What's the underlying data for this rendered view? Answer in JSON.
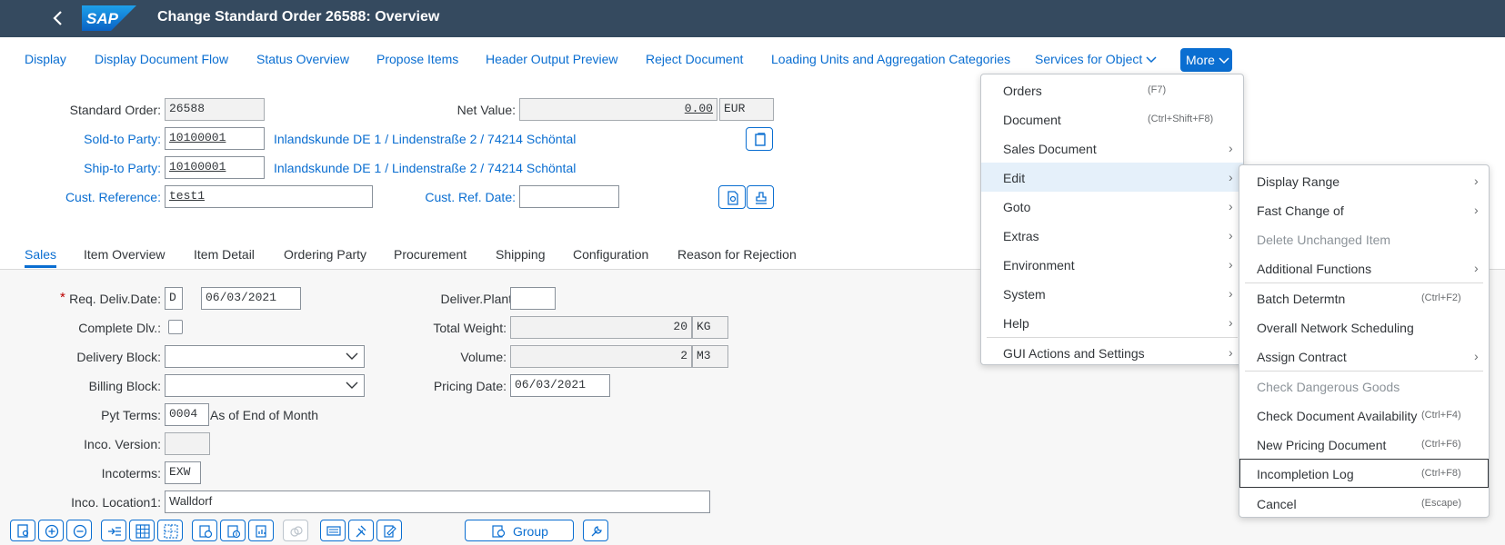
{
  "shell": {
    "title": "Change Standard Order 26588: Overview",
    "logo_text": "SAP"
  },
  "toolbar": {
    "display": "Display",
    "doc_flow": "Display Document Flow",
    "status": "Status Overview",
    "propose": "Propose Items",
    "output": "Header Output Preview",
    "reject": "Reject Document",
    "loading": "Loading Units and Aggregation Categories",
    "services": "Services for Object",
    "more": "More"
  },
  "header": {
    "std_order_label": "Standard Order:",
    "std_order_value": "26588",
    "net_value_label": "Net Value:",
    "net_value": "0.00",
    "currency": "EUR",
    "sold_to_label": "Sold-to Party:",
    "sold_to_value": "10100001",
    "sold_to_desc": "Inlandskunde DE 1 / Lindenstraße 2 / 74214 Schöntal",
    "ship_to_label": "Ship-to Party:",
    "ship_to_value": "10100001",
    "ship_to_desc": "Inlandskunde DE 1 / Lindenstraße 2 / 74214 Schöntal",
    "cust_ref_label": "Cust. Reference:",
    "cust_ref_value": "test1",
    "cust_ref_date_label": "Cust. Ref. Date:",
    "cust_ref_date_value": ""
  },
  "tabs": [
    "Sales",
    "Item Overview",
    "Item Detail",
    "Ordering Party",
    "Procurement",
    "Shipping",
    "Configuration",
    "Reason for Rejection"
  ],
  "sales": {
    "req_deliv_label": "Req. Deliv.Date:",
    "req_deliv_type": "D",
    "req_deliv_date": "06/03/2021",
    "complete_dlv_label": "Complete Dlv.:",
    "delivery_block_label": "Delivery Block:",
    "billing_block_label": "Billing Block:",
    "pyt_terms_label": "Pyt Terms:",
    "pyt_terms_value": "0004",
    "pyt_terms_desc": "As of End of Month",
    "inco_version_label": "Inco. Version:",
    "incoterms_label": "Incoterms:",
    "incoterms_value": "EXW",
    "inco_location_label": "Inco. Location1:",
    "inco_location_value": "Walldorf",
    "deliver_plant_label": "Deliver.Plant:",
    "total_weight_label": "Total Weight:",
    "total_weight_value": "20",
    "total_weight_unit": "KG",
    "volume_label": "Volume:",
    "volume_value": "2",
    "volume_unit": "M3",
    "pricing_date_label": "Pricing Date:",
    "pricing_date_value": "06/03/2021"
  },
  "bottom": {
    "group_label": "Group"
  },
  "more_menu": [
    {
      "label": "Orders",
      "shortcut": "(F7)"
    },
    {
      "label": "Document",
      "shortcut": "(Ctrl+Shift+F8)"
    },
    {
      "label": "Sales Document",
      "shortcut": ""
    },
    {
      "label": "Edit",
      "shortcut": ""
    },
    {
      "label": "Goto",
      "shortcut": ""
    },
    {
      "label": "Extras",
      "shortcut": ""
    },
    {
      "label": "Environment",
      "shortcut": ""
    },
    {
      "label": "System",
      "shortcut": ""
    },
    {
      "label": "Help",
      "shortcut": ""
    },
    {
      "label": "GUI Actions and Settings",
      "shortcut": ""
    }
  ],
  "edit_menu": [
    {
      "label": "Display Range",
      "shortcut": ""
    },
    {
      "label": "Fast Change of",
      "shortcut": ""
    },
    {
      "label": "Delete Unchanged Item",
      "shortcut": ""
    },
    {
      "label": "Additional Functions",
      "shortcut": ""
    },
    {
      "label": "Batch Determtn",
      "shortcut": "(Ctrl+F2)"
    },
    {
      "label": "Overall Network Scheduling",
      "shortcut": ""
    },
    {
      "label": "Assign Contract",
      "shortcut": ""
    },
    {
      "label": "Check Dangerous Goods",
      "shortcut": ""
    },
    {
      "label": "Check Document Availability",
      "shortcut": "(Ctrl+F4)"
    },
    {
      "label": "New Pricing Document",
      "shortcut": "(Ctrl+F6)"
    },
    {
      "label": "Incompletion Log",
      "shortcut": "(Ctrl+F8)"
    },
    {
      "label": "Cancel",
      "shortcut": "(Escape)"
    }
  ],
  "colors": {
    "shell": "#354a5f",
    "accent": "#0a6ed1",
    "highlight": "#e5f0fa"
  }
}
